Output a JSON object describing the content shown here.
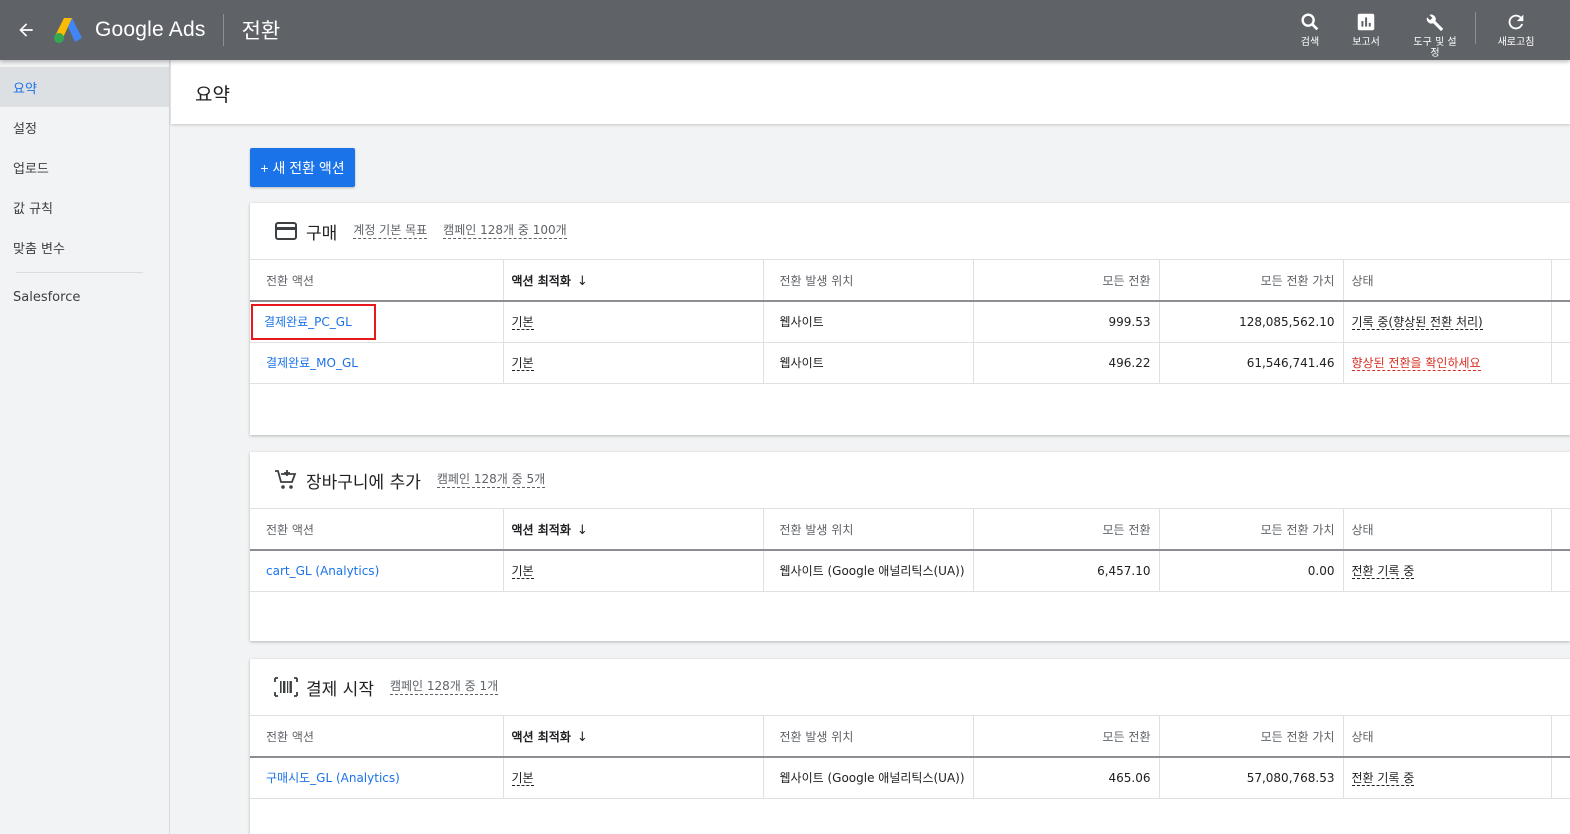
{
  "topbar": {
    "brand": "Google Ads",
    "page_name": "전환",
    "tools": {
      "search": "검색",
      "reports": "보고서",
      "tools": "도구 및 설정",
      "refresh": "새로고침"
    }
  },
  "sidebar": {
    "items": [
      "요약",
      "설정",
      "업로드",
      "값 규칙",
      "맞춤 변수"
    ],
    "extra": "Salesforce"
  },
  "header": {
    "title": "요약"
  },
  "new_button": "+ 새 전환 액션",
  "columns": {
    "action": "전환 액션",
    "optimization": "액션 최적화",
    "sort_arrow": "↓",
    "source": "전환 발생 위치",
    "all_conv": "모든 전환",
    "all_value": "모든 전환 가치",
    "status": "상태"
  },
  "sections": [
    {
      "title": "구매",
      "tags": [
        "계정 기본 목표",
        "캠페인 128개 중 100개"
      ],
      "rows": [
        {
          "action": "결제완료_PC_GL",
          "optimization": "기본",
          "source": "웹사이트",
          "all_conv": "999.53",
          "all_value": "128,085,562.10",
          "status": "기록 중(향상된 전환 처리)"
        },
        {
          "action": "결제완료_MO_GL",
          "optimization": "기본",
          "source": "웹사이트",
          "all_conv": "496.22",
          "all_value": "61,546,741.46",
          "status": "향상된 전환을 확인하세요"
        }
      ]
    },
    {
      "title": "장바구니에 추가",
      "tags": [
        "캠페인 128개 중 5개"
      ],
      "rows": [
        {
          "action": "cart_GL (Analytics)",
          "optimization": "기본",
          "source": "웹사이트 (Google 애널리틱스(UA))",
          "all_conv": "6,457.10",
          "all_value": "0.00",
          "status": "전환 기록 중"
        }
      ]
    },
    {
      "title": "결제 시작",
      "tags": [
        "캠페인 128개 중 1개"
      ],
      "rows": [
        {
          "action": "구매시도_GL (Analytics)",
          "optimization": "기본",
          "source": "웹사이트 (Google 애널리틱스(UA))",
          "all_conv": "465.06",
          "all_value": "57,080,768.53",
          "status": "전환 기록 중"
        }
      ]
    }
  ],
  "colors": {
    "topbar": "#5f6368",
    "accent": "#1a73e8",
    "warning": "#d93025",
    "highlight": "#e8171c"
  }
}
